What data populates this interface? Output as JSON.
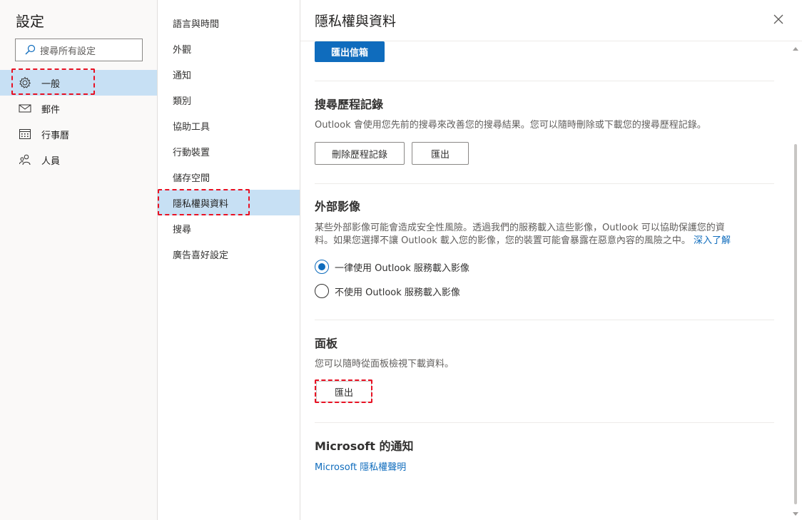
{
  "left": {
    "title": "設定",
    "search_placeholder": "搜尋所有設定",
    "items": [
      {
        "label": "一般",
        "icon": "gear-icon"
      },
      {
        "label": "郵件",
        "icon": "mail-icon"
      },
      {
        "label": "行事曆",
        "icon": "calendar-icon"
      },
      {
        "label": "人員",
        "icon": "people-icon"
      }
    ]
  },
  "middle": {
    "items": [
      "語言與時間",
      "外觀",
      "通知",
      "類別",
      "協助工具",
      "行動裝置",
      "儲存空間",
      "隱私權與資料",
      "搜尋",
      "廣告喜好設定"
    ],
    "selected": "隱私權與資料"
  },
  "right": {
    "title": "隱私權與資料",
    "export_mailbox_button": "匯出信箱",
    "search_history": {
      "title": "搜尋歷程記錄",
      "desc": "Outlook 會使用您先前的搜尋來改善您的搜尋結果。您可以隨時刪除或下載您的搜尋歷程記錄。",
      "delete_button": "刪除歷程記錄",
      "export_button": "匯出"
    },
    "external_images": {
      "title": "外部影像",
      "desc_line1": "某些外部影像可能會造成安全性風險。透過我們的服務載入這些影像，Outlook 可以協助保護您的資",
      "desc_line2": "料。如果您選擇不讓 Outlook 載入您的影像，您的裝置可能會暴露在惡意內容的風險之中。",
      "learn_more": "深入了解",
      "option_always": "一律使用 Outlook 服務載入影像",
      "option_never": "不使用 Outlook 服務載入影像"
    },
    "panel": {
      "title": "面板",
      "desc": "您可以隨時從面板檢視下載資料。",
      "export_button": "匯出"
    },
    "notices": {
      "title": "Microsoft 的通知",
      "link": "Microsoft 隱私權聲明"
    }
  }
}
